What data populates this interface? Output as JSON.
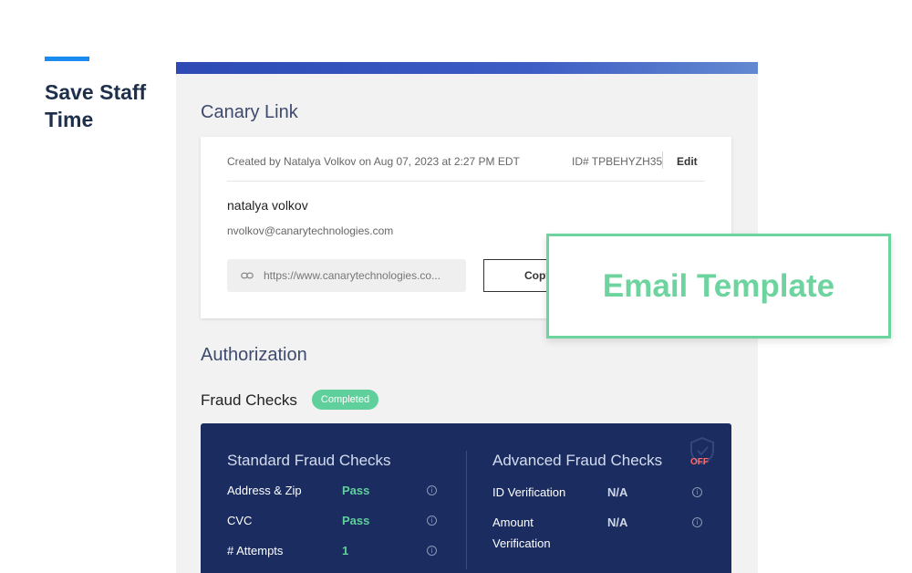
{
  "hero": {
    "title": "Save Staff Time"
  },
  "canary_link": {
    "section_title": "Canary Link",
    "created_by": "Created by Natalya Volkov on Aug 07, 2023 at 2:27 PM EDT",
    "id_label": "ID# TPBEHYZH35",
    "edit_label": "Edit",
    "name": "natalya volkov",
    "email": "nvolkov@canarytechnologies.com",
    "link_value": "https://www.canarytechnologies.co...",
    "copy_label": "Copy",
    "link_icon": "link-icon"
  },
  "authorization": {
    "section_title": "Authorization",
    "fraud_title": "Fraud Checks",
    "status_badge": "Completed",
    "standard": {
      "title": "Standard Fraud Checks",
      "rows": [
        {
          "label": "Address & Zip",
          "value": "Pass"
        },
        {
          "label": "CVC",
          "value": "Pass"
        },
        {
          "label": "# Attempts",
          "value": "1"
        }
      ]
    },
    "advanced": {
      "title": "Advanced Fraud Checks",
      "status": "OFF",
      "rows": [
        {
          "label": "ID Verification",
          "value": "N/A"
        },
        {
          "label": "Amount Verification",
          "value": "N/A"
        }
      ]
    }
  },
  "overlay": {
    "label": "Email Template"
  },
  "colors": {
    "accent_blue": "#1a8cf0",
    "navy": "#1b2d60",
    "green": "#5fd09b",
    "overlay_green": "#6ed49f",
    "off_red": "#ff6b6b"
  }
}
